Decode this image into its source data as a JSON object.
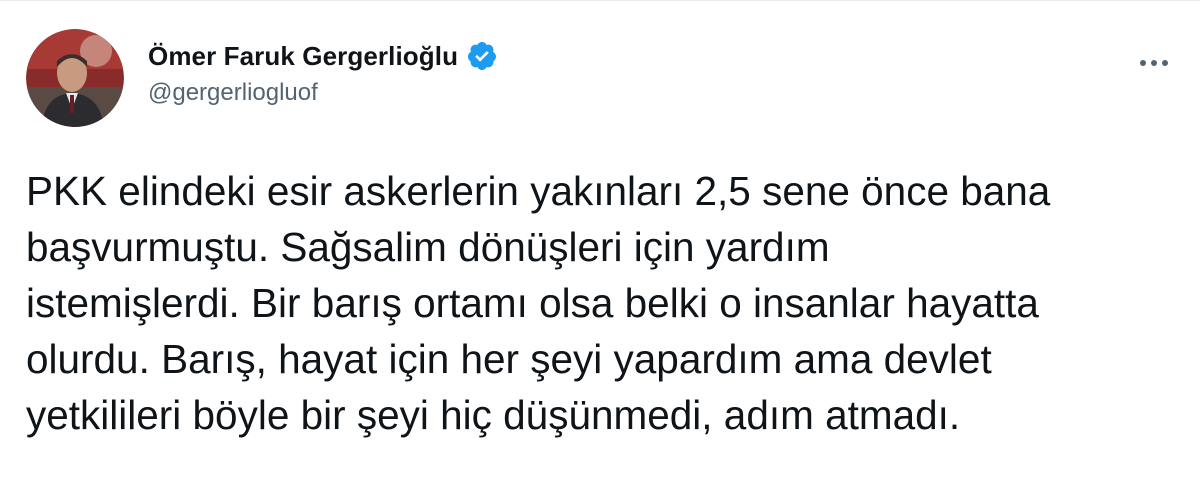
{
  "author": {
    "display_name": "Ömer Faruk Gergerlioğlu",
    "handle": "@gergerliogluof",
    "verified": true
  },
  "tweet": {
    "text": "PKK elindeki esir askerlerin yakınları 2,5 sene önce bana\nbaşvurmuştu. Sağsalim dönüşleri için yardım\nistemişlerdi. Bir barış ortamı olsa belki o insanlar hayatta\nolurdu. Barış, hayat için her şeyi yapardım ama devlet\nyetkilileri böyle bir şeyi hiç düşünmedi, adım atmadı."
  },
  "icons": {
    "avatar": "profile-photo",
    "verified": "verified-badge-icon",
    "more": "more-options-icon"
  },
  "colors": {
    "text": "#0f1419",
    "secondary_text": "#536471",
    "verified_blue": "#1d9bf0",
    "icon_gray": "#536471"
  }
}
